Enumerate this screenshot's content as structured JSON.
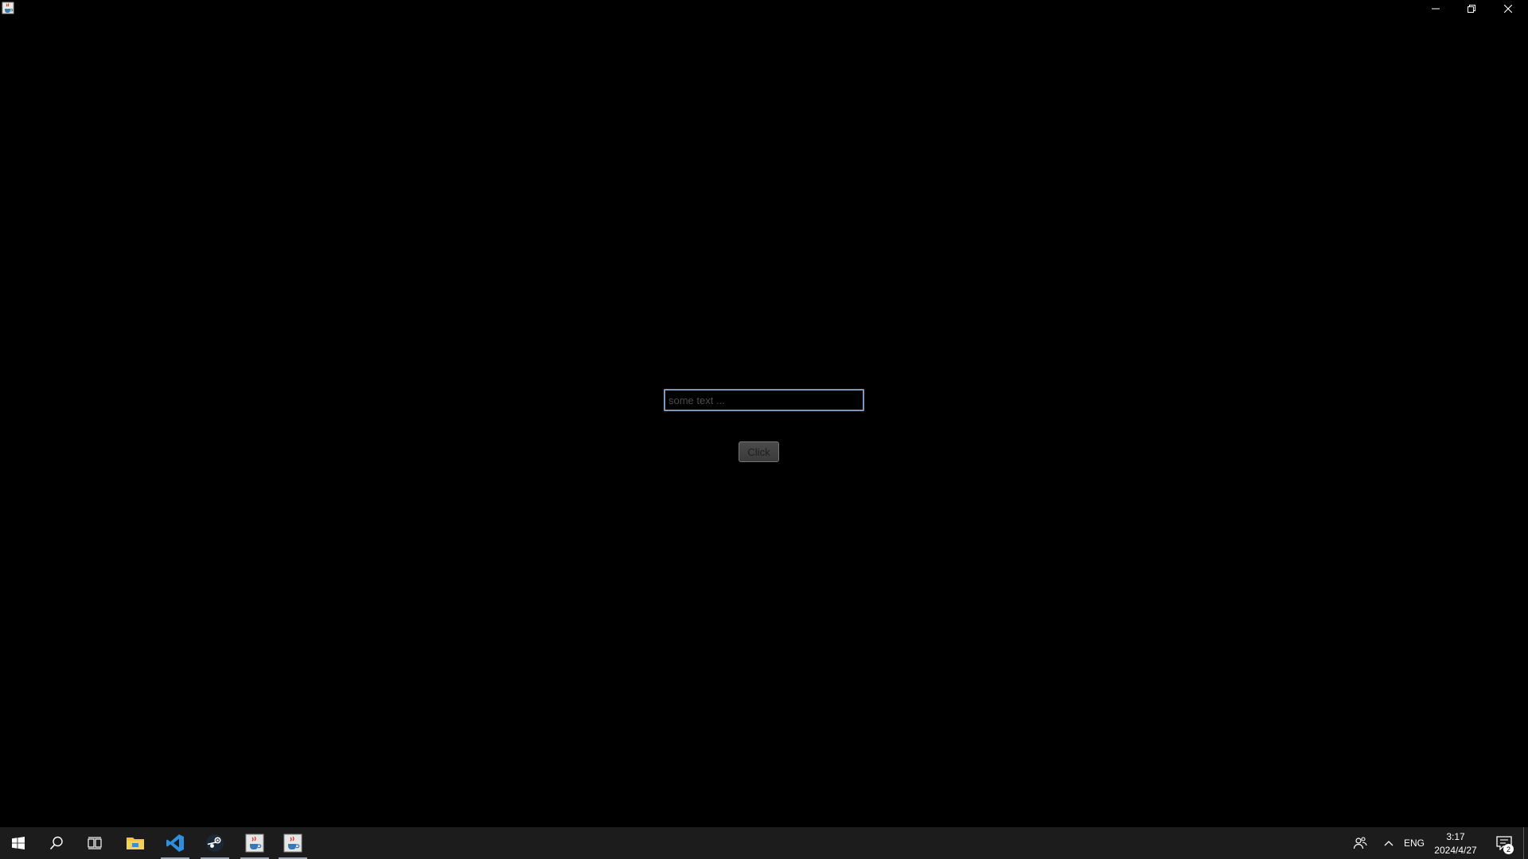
{
  "window": {
    "app_icon": "java-cup-icon",
    "controls": {
      "minimize": "minimize-icon",
      "restore": "restore-icon",
      "close": "close-icon"
    }
  },
  "form": {
    "text_field": {
      "value": "",
      "placeholder": "some text ..."
    },
    "button_label": "Click"
  },
  "taskbar": {
    "pinned": [
      {
        "name": "start",
        "icon": "windows-logo-icon"
      },
      {
        "name": "search",
        "icon": "search-icon"
      },
      {
        "name": "task-view",
        "icon": "task-view-icon"
      },
      {
        "name": "file-explorer",
        "icon": "folder-icon"
      },
      {
        "name": "vscode",
        "icon": "vscode-icon",
        "active": true
      },
      {
        "name": "steam",
        "icon": "steam-icon",
        "active": true
      },
      {
        "name": "java-app-1",
        "icon": "java-cup-icon",
        "active": true
      },
      {
        "name": "java-app-2",
        "icon": "java-cup-icon",
        "active": true
      }
    ],
    "tray": {
      "people_icon": "people-icon",
      "overflow_icon": "chevron-up-icon",
      "language": "ENG",
      "time": "3:17",
      "date": "2024/4/27",
      "notification_icon": "action-center-icon",
      "notification_count": "2"
    }
  },
  "colors": {
    "background": "#000000",
    "taskbar": "#1c1c1c",
    "field_border": "#7d97b9",
    "vscode_blue": "#2d8fe0",
    "folder_yellow": "#f3c33b"
  }
}
